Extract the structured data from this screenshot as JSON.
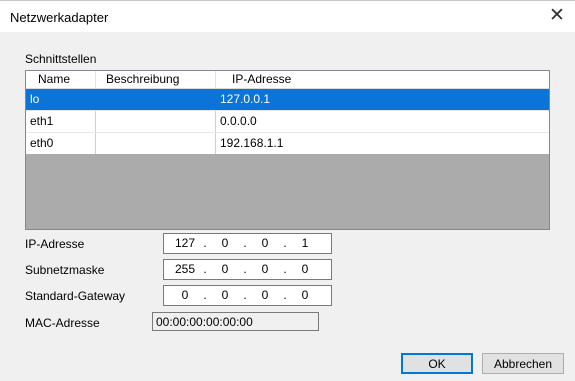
{
  "window": {
    "title": "Netzwerkadapter"
  },
  "interfaces": {
    "group_label": "Schnittstellen",
    "columns": [
      "Name",
      "Beschreibung",
      "IP-Adresse"
    ],
    "rows": [
      {
        "name": "lo",
        "description": "",
        "ip": "127.0.0.1",
        "selected": true
      },
      {
        "name": "eth1",
        "description": "",
        "ip": "0.0.0.0",
        "selected": false
      },
      {
        "name": "eth0",
        "description": "",
        "ip": "192.168.1.1",
        "selected": false
      }
    ]
  },
  "fields": {
    "ip": {
      "label": "IP-Adresse",
      "octets": [
        "127",
        "0",
        "0",
        "1"
      ]
    },
    "subnet": {
      "label": "Subnetzmaske",
      "octets": [
        "255",
        "0",
        "0",
        "0"
      ]
    },
    "gateway": {
      "label": "Standard-Gateway",
      "octets": [
        "0",
        "0",
        "0",
        "0"
      ]
    },
    "mac": {
      "label": "MAC-Adresse",
      "value": "00:00:00:00:00:00"
    }
  },
  "buttons": {
    "ok": "OK",
    "cancel": "Abbrechen"
  },
  "icons": {
    "close": "close-icon"
  },
  "colors": {
    "selection": "#0a74d8",
    "listview_empty": "#ababab",
    "dialog_bg": "#f0f0f0"
  }
}
